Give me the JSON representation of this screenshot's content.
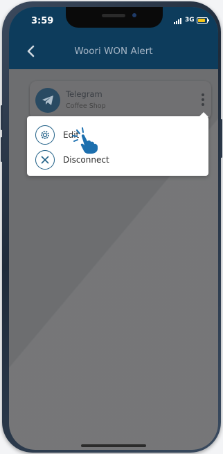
{
  "status_bar": {
    "time": "3:59",
    "network": "3G"
  },
  "nav": {
    "title": "Woori WON Alert"
  },
  "card": {
    "title": "Telegram",
    "subtitle": "Coffee Shop"
  },
  "menu": [
    {
      "label": "Edit",
      "icon": "gear-icon"
    },
    {
      "label": "Disconnect",
      "icon": "close-icon"
    }
  ],
  "colors": {
    "nav_bg": "#0d3c5c",
    "accent": "#1f5f86",
    "battery": "#f5c518"
  }
}
